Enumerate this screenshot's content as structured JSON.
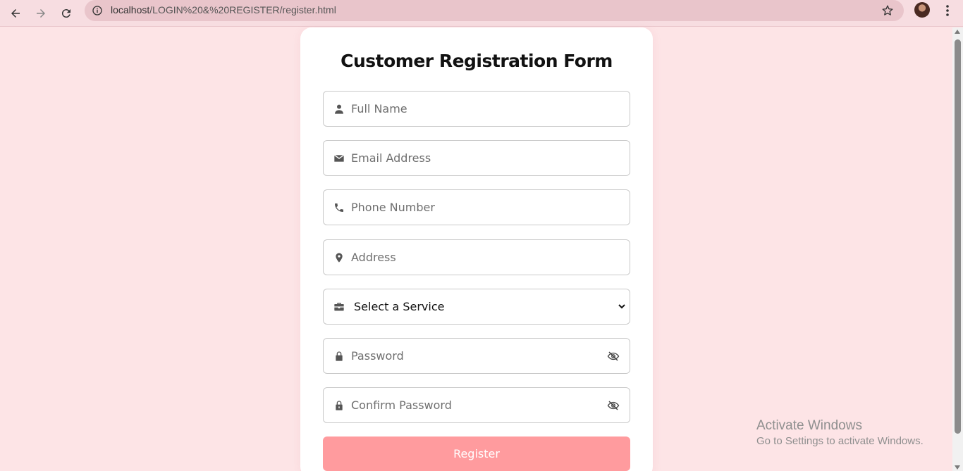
{
  "browser": {
    "url_host": "localhost",
    "url_path": "/LOGIN%20&%20REGISTER/register.html"
  },
  "form": {
    "title": "Customer Registration Form",
    "fields": {
      "full_name": {
        "placeholder": "Full Name",
        "icon": "user-icon"
      },
      "email": {
        "placeholder": "Email Address",
        "icon": "envelope-icon"
      },
      "phone": {
        "placeholder": "Phone Number",
        "icon": "phone-icon"
      },
      "address": {
        "placeholder": "Address",
        "icon": "location-pin-icon"
      },
      "service": {
        "selected": "Select a Service",
        "icon": "briefcase-icon"
      },
      "password": {
        "placeholder": "Password",
        "icon": "lock-icon"
      },
      "confirm_password": {
        "placeholder": "Confirm Password",
        "icon": "lock-icon"
      }
    },
    "submit_label": "Register"
  },
  "watermark": {
    "line1": "Activate Windows",
    "line2": "Go to Settings to activate Windows."
  },
  "colors": {
    "page_bg": "#fde4e6",
    "button": "#ff9b9e",
    "card": "#ffffff"
  }
}
